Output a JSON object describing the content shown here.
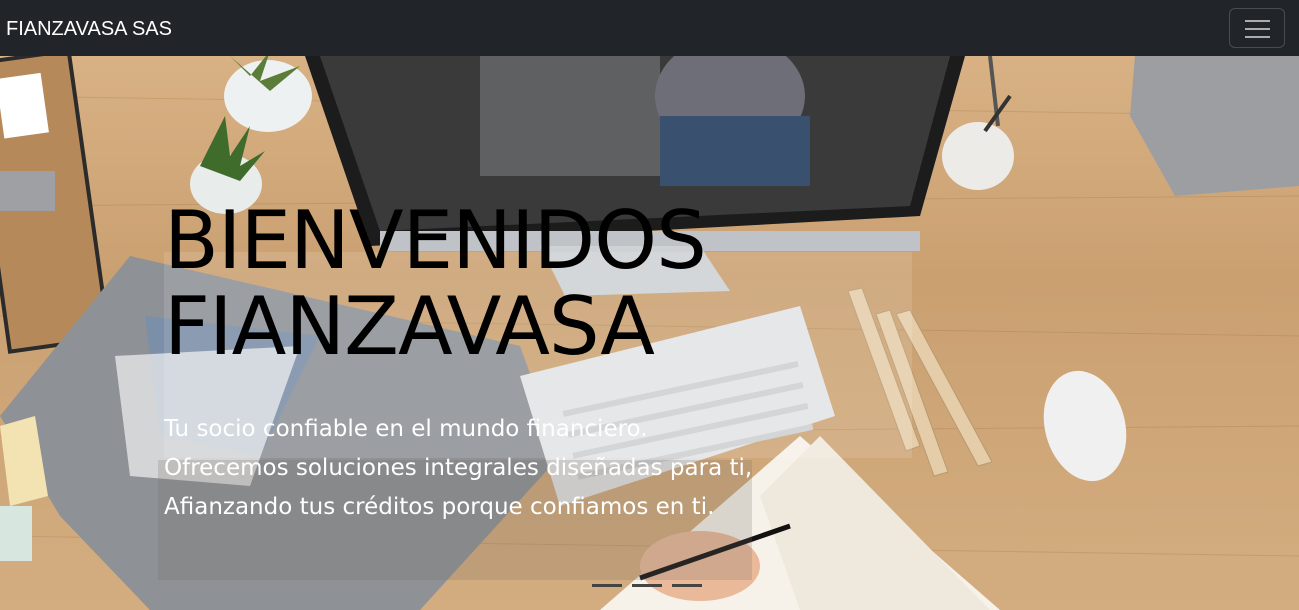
{
  "navbar": {
    "brand": "FIANZAVASA SAS",
    "toggler_icon": "hamburger-menu-icon"
  },
  "hero": {
    "title": "BIENVENIDOS FIANZAVASA",
    "lines": [
      "Tu socio confiable en el mundo financiero.",
      "Ofrecemos soluciones integrales diseñadas para ti,",
      "Afianzando tus créditos porque confiamos en ti."
    ],
    "slide_count": 3
  },
  "colors": {
    "navbar_bg": "#212529",
    "title": "#000000",
    "subtitle": "#ffffff"
  }
}
